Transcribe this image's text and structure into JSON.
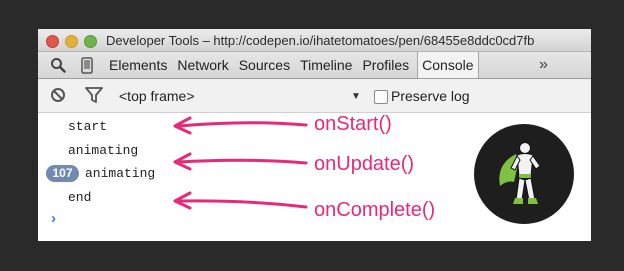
{
  "window": {
    "title": "Developer Tools – http://codepen.io/ihatetomatoes/pen/68455e8ddc0cd7fb"
  },
  "tabs": [
    {
      "label": "Elements"
    },
    {
      "label": "Network"
    },
    {
      "label": "Sources"
    },
    {
      "label": "Timeline"
    },
    {
      "label": "Profiles"
    },
    {
      "label": "Console",
      "active": true
    }
  ],
  "tab_overflow": "»",
  "toolbar": {
    "frame_select": "<top frame>",
    "preserve_log": "Preserve log",
    "preserve_checked": false,
    "icons": [
      "clear-console-icon",
      "filter-icon",
      "dropdown-caret-icon"
    ]
  },
  "console": {
    "lines": [
      {
        "text": "start"
      },
      {
        "text": "animating"
      },
      {
        "text": "animating",
        "count": "107"
      },
      {
        "text": "end"
      }
    ],
    "prompt": "›"
  },
  "annotations": {
    "on_start": "onStart()",
    "on_update": "onUpdate()",
    "on_complete": "onComplete()",
    "color": "#e8297a"
  },
  "colors": {
    "badge": "#7289b5",
    "prompt": "#3b7bd6",
    "annotation": "#e8297a"
  }
}
